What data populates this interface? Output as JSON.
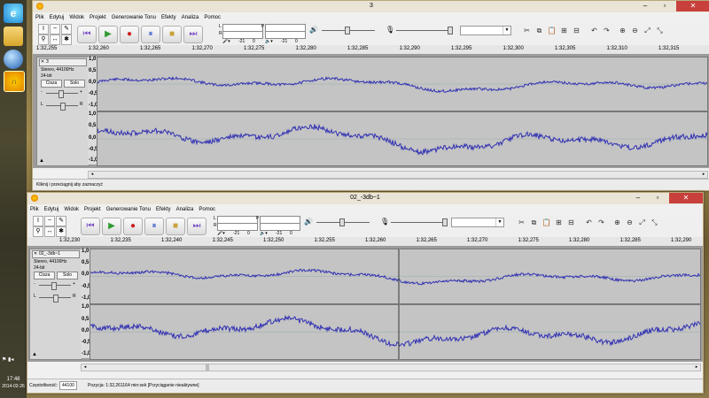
{
  "desktop": {
    "clock_time": "17:48",
    "clock_date": "2014-02-26"
  },
  "colors": {
    "waveform": "#3131b3",
    "title_bg": "#e9e4d6",
    "track_bg": "#c4c4c4",
    "close_red": "#c7403b"
  },
  "menu": [
    "Plik",
    "Edytuj",
    "Widok",
    "Projekt",
    "Generowanie Tonu",
    "Efekty",
    "Analiza",
    "Pomoc"
  ],
  "meters": {
    "left": "L",
    "right": "R",
    "play": "P",
    "db1": "-21",
    "db0": "0"
  },
  "window_top": {
    "title": "3",
    "ruler": [
      "1:32,255",
      "1:32,260",
      "1:32,265",
      "1:32,270",
      "1:32,275",
      "1:32,280",
      "1:32,285",
      "1:32,290",
      "1:32,295",
      "1:32,300",
      "1:32,305",
      "1:32,310",
      "1:32,315"
    ],
    "track": {
      "name": "3",
      "format": "Stereo, 44100Hz",
      "bits": "24-bit",
      "mute": "Cisza",
      "solo": "Solo",
      "left": "L",
      "right": "R",
      "minus": "-",
      "plus": "+"
    },
    "vscale": [
      "1,0",
      "0,5",
      "0,0",
      "-0,5",
      "-1,0"
    ],
    "status": "Kliknij i przeciągnij aby zaznaczyć"
  },
  "window_bottom": {
    "title": "02_-3db~1",
    "ruler": [
      "1:32,230",
      "1:32,235",
      "1:32,240",
      "1:32,245",
      "1:32,250",
      "1:32,255",
      "1:32,260",
      "1:32,265",
      "1:32,270",
      "1:32,275",
      "1:32,280",
      "1:32,285",
      "1:32,290"
    ],
    "track": {
      "name": "02_-3db~1",
      "format": "Stereo, 44100Hz",
      "bits": "24-bit",
      "mute": "Cisza",
      "solo": "Solo",
      "left": "L",
      "right": "R",
      "minus": "-",
      "plus": "+"
    },
    "vscale": [
      "1,0",
      "0,5",
      "0,0",
      "-0,5",
      "-1,0"
    ],
    "rate_label": "Częstotliwość:",
    "rate_value": "44100",
    "position_text": "Pozycja: 1:32,261164 min:sek   [Przyciąganie nieaktywne]"
  }
}
